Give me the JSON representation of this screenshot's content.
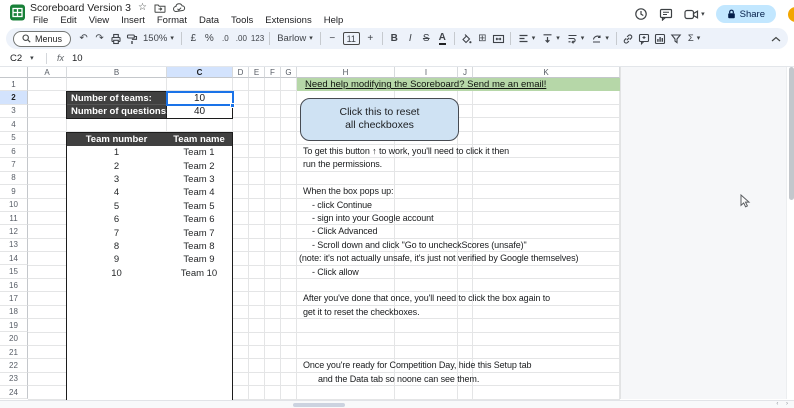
{
  "header": {
    "title": "Scoreboard Version 3",
    "menu_items": [
      "File",
      "Edit",
      "View",
      "Insert",
      "Format",
      "Data",
      "Tools",
      "Extensions",
      "Help"
    ],
    "share_label": "Share"
  },
  "toolbar": {
    "menus_label": "Menus",
    "undo": "↶",
    "redo": "↷",
    "zoom_value": "150%",
    "currency": "£",
    "percent": "%",
    "dec_decrease": ".0",
    "dec_increase": ".00",
    "number_format": "123",
    "font_name": "Barlow",
    "font_size_minus": "−",
    "font_size": "11",
    "font_size_plus": "+",
    "bold": "B",
    "italic": "I",
    "strikethrough": "S",
    "text_color": "A",
    "borders": "⊞",
    "align": "≡",
    "sigma": "Σ",
    "caret": "▾"
  },
  "formula_bar": {
    "name_box": "C2",
    "fx_label": "fx",
    "value": "10"
  },
  "sheet": {
    "selected_cell": "C2",
    "selected_column": "C",
    "selected_row": 2,
    "row_count": 24,
    "column_headers": [
      "A",
      "B",
      "C",
      "D",
      "E",
      "F",
      "G",
      "H",
      "I",
      "J",
      "K"
    ],
    "help_link": "Need help modifying the Scoreboard? Send me an email!",
    "settings_table": {
      "rows": [
        {
          "label": "Number of teams:",
          "value": "10"
        },
        {
          "label": "Number of questions:",
          "value": "40"
        }
      ]
    },
    "team_table": {
      "headers": [
        "Team number",
        "Team name"
      ],
      "rows": [
        [
          "1",
          "Team 1"
        ],
        [
          "2",
          "Team 2"
        ],
        [
          "3",
          "Team 3"
        ],
        [
          "4",
          "Team 4"
        ],
        [
          "5",
          "Team 5"
        ],
        [
          "6",
          "Team 6"
        ],
        [
          "7",
          "Team 7"
        ],
        [
          "8",
          "Team 8"
        ],
        [
          "9",
          "Team 9"
        ],
        [
          "10",
          "Team 10"
        ]
      ]
    },
    "reset_button": {
      "line1": "Click this to reset",
      "line2": "all checkboxes"
    },
    "notes": [
      {
        "row": 6,
        "indent": 0,
        "text": "To get this button ↑ to work, you'll need to click it then"
      },
      {
        "row": 7,
        "indent": 0,
        "text": "run the permissions."
      },
      {
        "row": 9,
        "indent": 0,
        "text": "When the box pops up:"
      },
      {
        "row": 10,
        "indent": 1,
        "text": "- click Continue"
      },
      {
        "row": 11,
        "indent": 1,
        "text": "- sign into your Google account"
      },
      {
        "row": 12,
        "indent": 1,
        "text": "- Click Advanced"
      },
      {
        "row": 13,
        "indent": 1,
        "text": "- Scroll down and click \"Go to uncheckScores (unsafe)\""
      },
      {
        "row": 14,
        "indent": -1,
        "text": "(note: it's not actually unsafe, it's just not verified by Google themselves)"
      },
      {
        "row": 15,
        "indent": 1,
        "text": "- Click allow"
      },
      {
        "row": 17,
        "indent": 0,
        "text": "After you've done that once, you'll need to click the box again to"
      },
      {
        "row": 18,
        "indent": 0,
        "text": "get it to reset the checkboxes."
      },
      {
        "row": 22,
        "indent": 0,
        "text": "Once you're ready for Competition Day, hide this Setup tab"
      },
      {
        "row": 23,
        "indent": 2,
        "text": "and the Data tab so noone can see them."
      }
    ]
  },
  "colors": {
    "accent": "#1a73e8",
    "header_selection": "#d3e3fd",
    "dark_cell": "#404040",
    "highlight_green": "#b6d7a8",
    "button_blue": "#cfe2f3",
    "share_pill": "#c2e7ff",
    "toolbar_bg": "#edf2fa",
    "logo_green": "#188038"
  }
}
